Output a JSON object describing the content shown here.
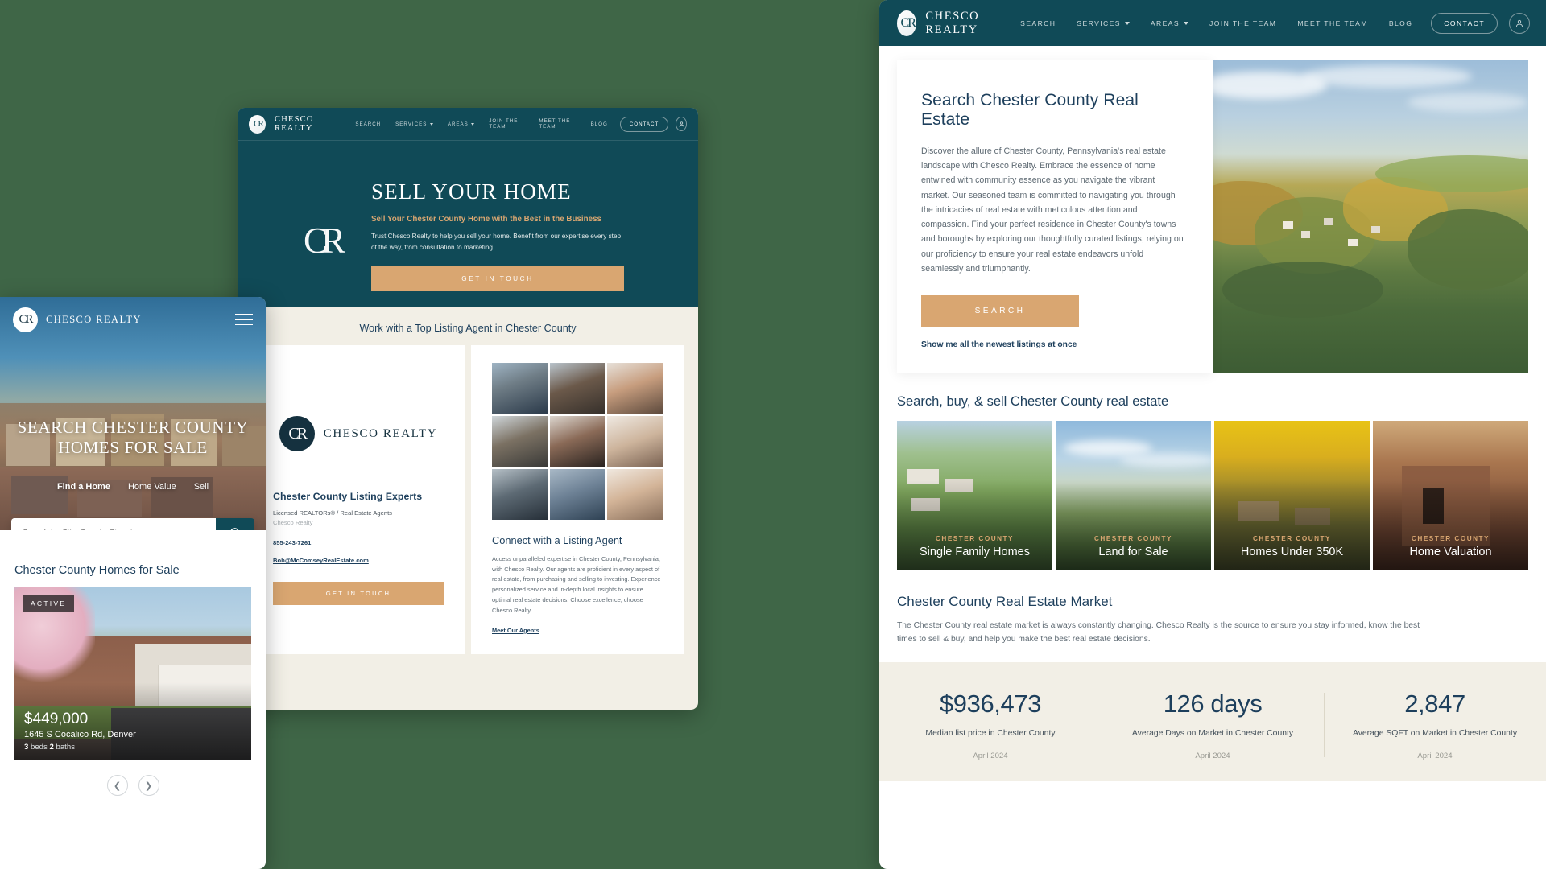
{
  "brand": {
    "badge_mark": "CR",
    "name": "CHESCO REALTY"
  },
  "desktop": {
    "nav": {
      "items": [
        {
          "label": "SEARCH",
          "caret": false
        },
        {
          "label": "SERVICES",
          "caret": true
        },
        {
          "label": "AREAS",
          "caret": true
        },
        {
          "label": "JOIN THE TEAM",
          "caret": false
        },
        {
          "label": "MEET THE TEAM",
          "caret": false
        },
        {
          "label": "BLOG",
          "caret": false
        }
      ],
      "contact_label": "CONTACT",
      "user_icon": "user-account-icon"
    },
    "hero": {
      "title": "Search Chester County Real Estate",
      "paragraph": "Discover the allure of Chester County, Pennsylvania's real estate landscape with Chesco Realty. Embrace the essence of home entwined with community essence as you navigate the vibrant market. Our seasoned team is committed to navigating you through the intricacies of real estate with meticulous attention and compassion. Find your perfect residence in Chester County's towns and boroughs by exploring our thoughtfully curated listings, relying on our proficiency to ensure your real estate endeavors unfold seamlessly and triumphantly.",
      "search_button": "SEARCH",
      "newest_link": "Show me all the newest listings at once"
    },
    "categories": {
      "heading": "Search, buy, & sell Chester County real estate",
      "cards": [
        {
          "kicker": "CHESTER COUNTY",
          "title": "Single Family Homes"
        },
        {
          "kicker": "CHESTER COUNTY",
          "title": "Land for Sale"
        },
        {
          "kicker": "CHESTER COUNTY",
          "title": "Homes Under 350K"
        },
        {
          "kicker": "CHESTER COUNTY",
          "title": "Home Valuation"
        }
      ]
    },
    "market": {
      "heading": "Chester County Real Estate Market",
      "paragraph": "The Chester County real estate market is always constantly changing. Chesco Realty is the source to ensure you stay informed, know the best times to sell & buy, and help you make the best real estate decisions.",
      "stats": [
        {
          "value": "$936,473",
          "label": "Median list price in Chester County",
          "date": "April 2024"
        },
        {
          "value": "126 days",
          "label": "Average Days on Market in Chester County",
          "date": "April 2024"
        },
        {
          "value": "2,847",
          "label": "Average SQFT on Market in Chester County",
          "date": "April 2024"
        }
      ]
    }
  },
  "tablet": {
    "nav": {
      "items": [
        {
          "label": "SEARCH",
          "caret": false
        },
        {
          "label": "SERVICES",
          "caret": true
        },
        {
          "label": "AREAS",
          "caret": true
        },
        {
          "label": "JOIN THE TEAM",
          "caret": false
        },
        {
          "label": "MEET THE TEAM",
          "caret": false
        },
        {
          "label": "BLOG",
          "caret": false
        }
      ],
      "contact_label": "CONTACT",
      "user_icon": "user-account-icon"
    },
    "hero": {
      "title": "SELL YOUR HOME",
      "subtitle": "Sell Your Chester County Home with the Best in the Business",
      "body": "Trust Chesco Realty to help you sell your home. Benefit from our expertise every step of the way, from consultation to marketing.",
      "cta": "GET IN TOUCH",
      "watermark": "CR"
    },
    "section_heading": "Work with a Top Listing Agent in Chester County",
    "left_card": {
      "logo_mark": "CR",
      "logo_text": "CHESCO REALTY",
      "title": "Chester County Listing Experts",
      "license": "Licensed REALTORs® / Real Estate Agents",
      "company": "Chesco Realty",
      "phone": "855-243-7261",
      "email": "Bob@McComseyRealEstate.com",
      "cta": "GET IN TOUCH"
    },
    "right_card": {
      "title": "Connect with a Listing Agent",
      "paragraph": "Access unparalleled expertise in Chester County, Pennsylvania, with Chesco Realty. Our agents are proficient in every aspect of real estate, from purchasing and selling to investing. Experience personalized service and in-depth local insights to ensure optimal real estate decisions. Choose excellence, choose Chesco Realty.",
      "link": "Meet Our Agents"
    }
  },
  "phone": {
    "brand_name": "CHESCO REALTY",
    "menu_icon": "hamburger-menu-icon",
    "hero_title": "SEARCH CHESTER COUNTY HOMES FOR SALE",
    "tabs": [
      {
        "label": "Find a Home",
        "active": true
      },
      {
        "label": "Home Value",
        "active": false
      },
      {
        "label": "Sell",
        "active": false
      }
    ],
    "search_placeholder": "Search by City, County, Zip, etc.",
    "search_icon": "magnifier-icon",
    "listing_heading": "Chester County Homes for Sale",
    "listing": {
      "status": "ACTIVE",
      "price": "$449,000",
      "address": "1645 S Cocalico Rd, Denver",
      "beds": "3",
      "beds_label": "beds",
      "baths": "2",
      "baths_label": "baths"
    },
    "prev_icon": "chevron-left-icon",
    "next_icon": "chevron-right-icon"
  },
  "colors": {
    "background_green": "#3f6647",
    "brand_teal": "#104a57",
    "accent_tan": "#d9a671",
    "heading_navy": "#1d3f5c",
    "stat_band": "#f2efe6"
  }
}
